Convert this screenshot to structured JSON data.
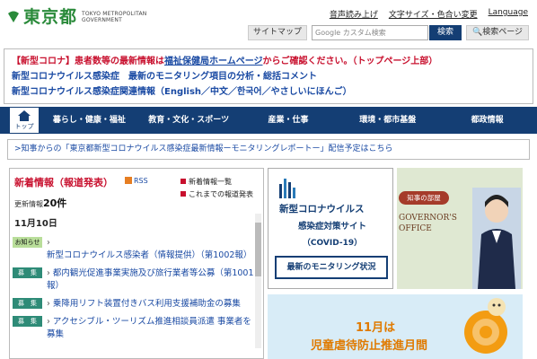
{
  "header": {
    "logo_text": "東京都",
    "logo_en_line1": "TOKYO METROPOLITAN",
    "logo_en_line2": "GOVERNMENT",
    "top_links": [
      "音声読み上げ",
      "文字サイズ・色合い変更",
      "Language"
    ],
    "sitemap_label": "サイトマップ",
    "search_placeholder": "Google カスタム検索",
    "search_button": "検索",
    "search_pages_button": "検索ページ"
  },
  "notice": {
    "line1_prefix": "【新型コロナ】患者数等の最新情報は",
    "line1_link": "福祉保健局ホームページ",
    "line1_suffix": "からご確認ください。（トップページ上部）",
    "line2": "新型コロナウイルス感染症　最新のモニタリング項目の分析・総括コメント",
    "line3": "新型コロナウイルス感染症関連情報（English／中文／한국어／やさしいにほんご）"
  },
  "nav": {
    "home_label": "トップ",
    "items": [
      "暮らし・健康・福祉",
      "教育・文化・スポーツ",
      "産業・仕事",
      "環境・都市基盤",
      "都政情報"
    ]
  },
  "banner_line": ">知事からの「東京都新型コロナウイルス感染症最新情報ーモニタリングレポートー」配信予定はこちら",
  "news": {
    "title": "新着情報（報道発表）",
    "rss": "RSS",
    "links": [
      "新着情報一覧",
      "これまでの報道発表"
    ],
    "count_label": "更新情報",
    "count_value": "20件",
    "date": "11月10日",
    "items": [
      {
        "tag": "お知らせ",
        "text": "新型コロナウイルス感染者（情報提供）（第1002報）"
      },
      {
        "tag": "募　集",
        "text": "都内観光促進事業実施及び旅行業者等公募（第1001報）"
      },
      {
        "tag": "募　集",
        "text": "乗降用リフト装置付きバス利用支援補助金の募集"
      },
      {
        "tag": "募　集",
        "text": "アクセシブル・ツーリズム推進相談員派遣 事業者を募集"
      }
    ]
  },
  "covid_card": {
    "line1": "新型コロナウイルス",
    "line2": "感染症対策サイト",
    "line3": "（COVID-19）",
    "button": "最新のモニタリング状況"
  },
  "governor_card": {
    "pill": "知事の部屋",
    "title": "GOVERNOR'S OFFICE"
  },
  "abuse_banner": {
    "line1": "11月は",
    "line2": "児童虐待防止推進月間"
  }
}
